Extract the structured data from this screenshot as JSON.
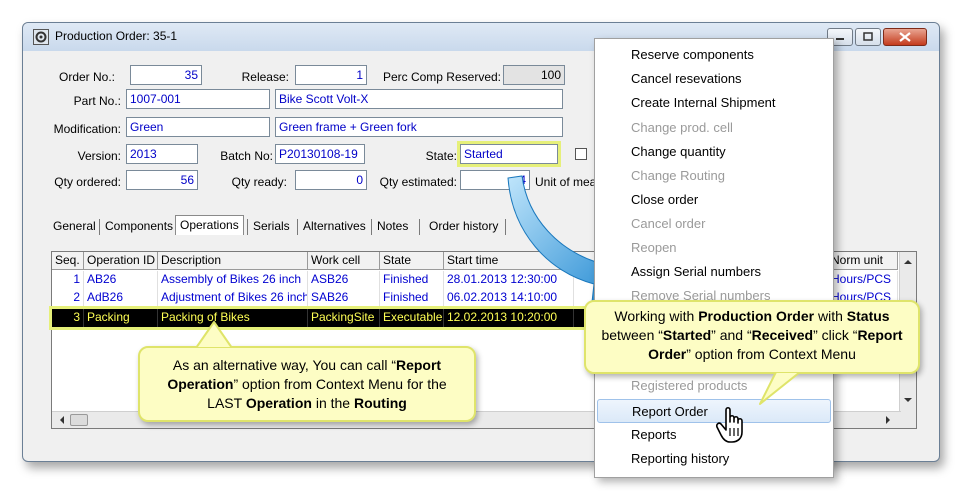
{
  "window": {
    "title": "Production Order: 35-1"
  },
  "form": {
    "order_no_label": "Order No.:",
    "order_no": "35",
    "release_label": "Release:",
    "release": "1",
    "perc_comp_label": "Perc Comp Reserved:",
    "perc_comp": "100",
    "part_no_label": "Part No.:",
    "part_no": "1007-001",
    "part_desc": "Bike Scott Volt-X",
    "modification_label": "Modification:",
    "modification": "Green",
    "modification_desc": "Green frame + Green fork",
    "version_label": "Version:",
    "version": "2013",
    "batch_no_label": "Batch No:",
    "batch_no": "P20130108-19",
    "state_label": "State:",
    "state": "Started",
    "qty_ordered_label": "Qty ordered:",
    "qty_ordered": "56",
    "qty_ready_label": "Qty ready:",
    "qty_ready": "0",
    "qty_estimated_label": "Qty estimated:",
    "qty_estimated": "4",
    "unit_label": "Unit of mea"
  },
  "tabs": [
    "General",
    "Components",
    "Operations",
    "Serials",
    "Alternatives",
    "Notes",
    "Order history"
  ],
  "grid": {
    "columns": [
      "Seq.",
      "Operation ID",
      "Description",
      "Work cell",
      "State",
      "Start time",
      "Norm unit"
    ],
    "rows": [
      {
        "seq": "1",
        "op_id": "AB26",
        "description": "Assembly of Bikes 26 inch",
        "work_cell": "ASB26",
        "state": "Finished",
        "start_time": "28.01.2013 12:30:00",
        "norm_unit": "Hours/PCS"
      },
      {
        "seq": "2",
        "op_id": "AdB26",
        "description": "Adjustment of Bikes 26 inch",
        "work_cell": "SAB26",
        "state": "Finished",
        "start_time": "06.02.2013 14:10:00",
        "norm_unit": "Hours/PCS"
      },
      {
        "seq": "3",
        "op_id": "Packing",
        "description": "Packing of Bikes",
        "work_cell": "PackingSite",
        "state": "Executable",
        "start_time": "12.02.2013 10:20:00",
        "norm_unit": ""
      }
    ]
  },
  "context_menu": {
    "items": [
      {
        "label": "Reserve components",
        "enabled": true
      },
      {
        "label": "Cancel resevations",
        "enabled": true
      },
      {
        "label": "Create Internal Shipment",
        "enabled": true
      },
      {
        "label": "Change prod. cell",
        "enabled": false
      },
      {
        "label": "Change quantity",
        "enabled": true
      },
      {
        "label": "Change Routing",
        "enabled": false
      },
      {
        "label": "Close order",
        "enabled": true
      },
      {
        "label": "Cancel order",
        "enabled": false
      },
      {
        "label": "Reopen",
        "enabled": false
      },
      {
        "label": "Assign Serial numbers",
        "enabled": true
      },
      {
        "label": "Remove Serial numbers",
        "enabled": false
      },
      {
        "label": "Registered products",
        "enabled": false
      },
      {
        "label": "Report Order",
        "enabled": true
      },
      {
        "label": "Reports",
        "enabled": true
      },
      {
        "label": "Reporting history",
        "enabled": true
      }
    ]
  },
  "callouts": {
    "left": {
      "p1": "As an alternative way, You can call “",
      "b1": "Report",
      "p2": "",
      "b2": "Operation",
      "p3": "” option from Context Menu for the LAST ",
      "b3": "Operation",
      "p4": " in the ",
      "b4": "Routing"
    },
    "right": {
      "p1": "Working with ",
      "b1": "Production Order",
      "p2": " with ",
      "b2": "Status",
      "p3": " between “",
      "b3": "Started",
      "p4": "” and “",
      "b4": "Received",
      "p5": "” click “",
      "b5": "Report Order",
      "p6": "” option from Context Menu"
    }
  },
  "colors": {
    "highlight": "#e6f07a",
    "callout_bg": "#fdfdc4",
    "arrow": "#3aa0e0",
    "link_text": "#0000c8"
  }
}
